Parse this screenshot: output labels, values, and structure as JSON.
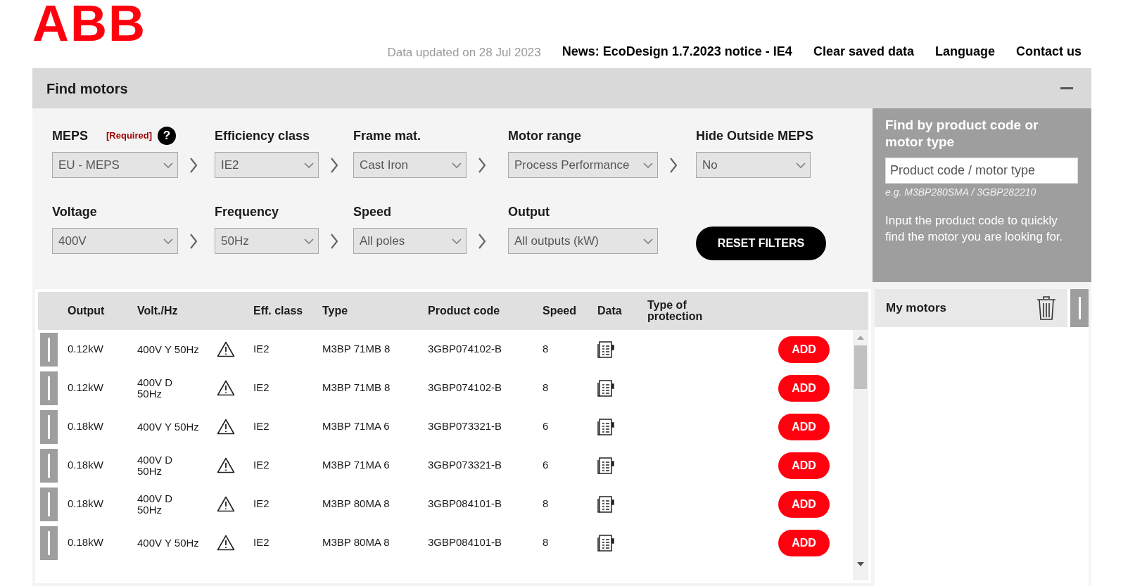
{
  "logo": "ABB",
  "header": {
    "updated": "Data updated on 28 Jul 2023",
    "links": [
      "News: EcoDesign 1.7.2023 notice - IE4",
      "Clear saved data",
      "Language",
      "Contact us"
    ]
  },
  "find_panel": {
    "title": "Find motors"
  },
  "filter_rows": [
    [
      {
        "label": "MEPS",
        "required": "[Required]",
        "help": "?",
        "value": "EU - MEPS"
      },
      {
        "label": "Efficiency class",
        "value": "IE2"
      },
      {
        "label": "Frame mat.",
        "value": "Cast Iron"
      },
      {
        "label": "Motor range",
        "value": "Process Performance"
      },
      {
        "label": "Hide Outside MEPS",
        "value": "No"
      }
    ],
    [
      {
        "label": "Voltage",
        "value": "400V"
      },
      {
        "label": "Frequency",
        "value": "50Hz"
      },
      {
        "label": "Speed",
        "value": "All poles"
      },
      {
        "label": "Output",
        "value": "All outputs (kW)"
      }
    ]
  ],
  "reset_button": "RESET FILTERS",
  "search": {
    "title": "Find by product code or motor type",
    "placeholder": "Product code / motor type",
    "example": "e.g. M3BP280SMA / 3GBP282210",
    "description": "Input the product code to quickly find the motor you are looking for."
  },
  "table": {
    "columns": [
      "Output",
      "Volt./Hz",
      "Eff. class",
      "Type",
      "Product code",
      "Speed",
      "Data",
      "Type of protection"
    ],
    "rows": [
      {
        "output": "0.12kW",
        "volt": "400V Y 50Hz",
        "eff": "IE2",
        "type": "M3BP 71MB 8",
        "code": "3GBP074102-B",
        "speed": "8",
        "add": "ADD"
      },
      {
        "output": "0.12kW",
        "volt": "400V D\n50Hz",
        "eff": "IE2",
        "type": "M3BP 71MB 8",
        "code": "3GBP074102-B",
        "speed": "8",
        "add": "ADD"
      },
      {
        "output": "0.18kW",
        "volt": "400V Y 50Hz",
        "eff": "IE2",
        "type": "M3BP 71MA 6",
        "code": "3GBP073321-B",
        "speed": "6",
        "add": "ADD"
      },
      {
        "output": "0.18kW",
        "volt": "400V D\n50Hz",
        "eff": "IE2",
        "type": "M3BP 71MA 6",
        "code": "3GBP073321-B",
        "speed": "6",
        "add": "ADD"
      },
      {
        "output": "0.18kW",
        "volt": "400V D\n50Hz",
        "eff": "IE2",
        "type": "M3BP 80MA 8",
        "code": "3GBP084101-B",
        "speed": "8",
        "add": "ADD"
      },
      {
        "output": "0.18kW",
        "volt": "400V Y 50Hz",
        "eff": "IE2",
        "type": "M3BP 80MA 8",
        "code": "3GBP084101-B",
        "speed": "8",
        "add": "ADD"
      }
    ]
  },
  "my_motors": {
    "title": "My motors"
  }
}
